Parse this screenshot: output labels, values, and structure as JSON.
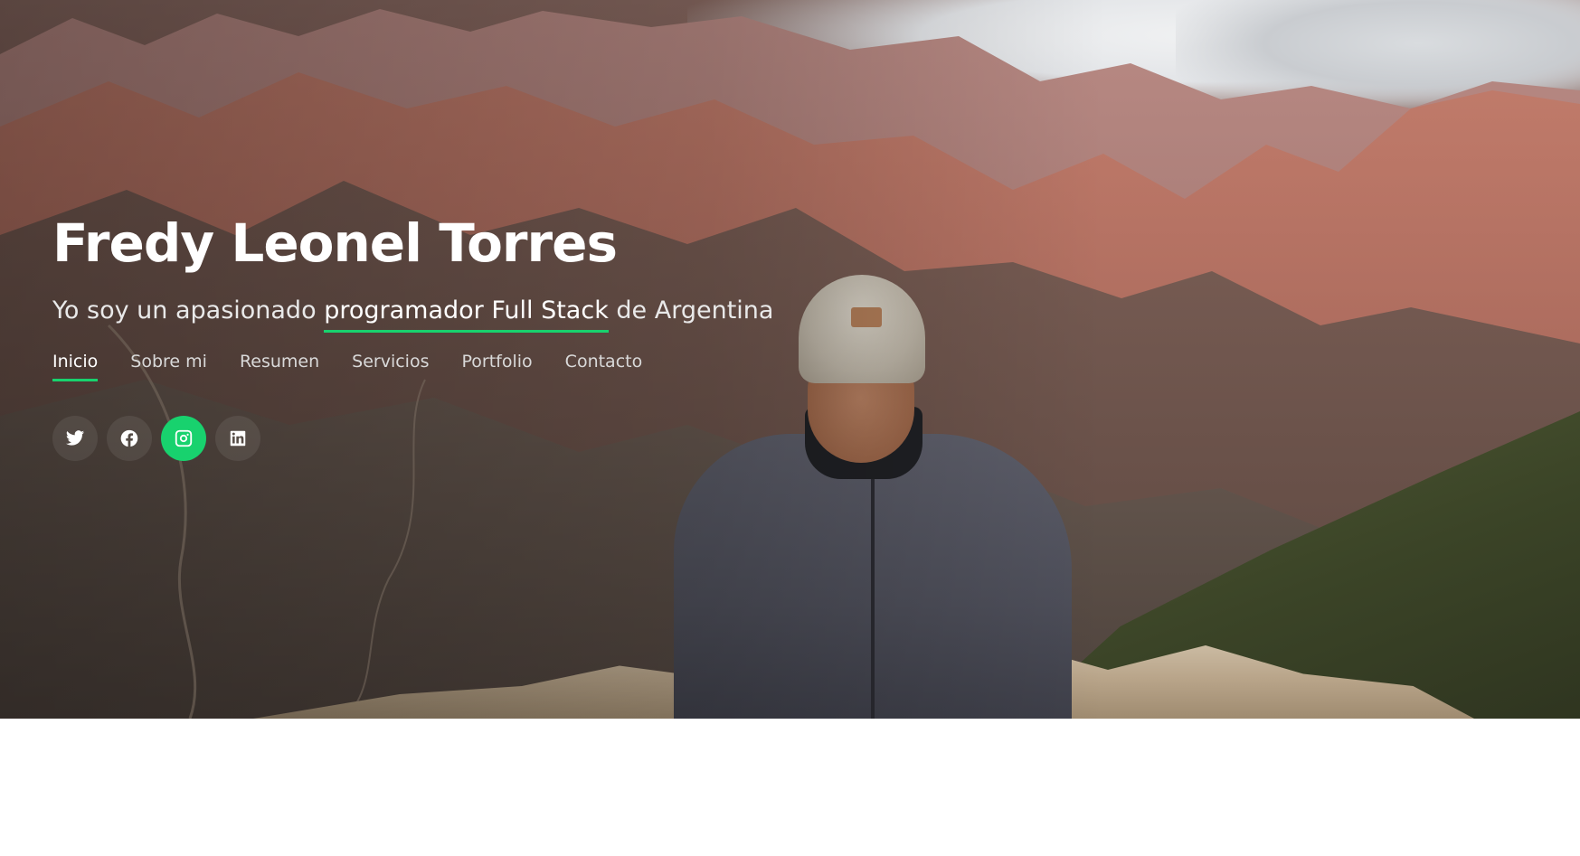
{
  "hero": {
    "name": "Fredy Leonel Torres",
    "tagline_prefix": "Yo soy un apasionado ",
    "tagline_highlight": "programador Full Stack",
    "tagline_suffix": " de Argentina"
  },
  "nav": {
    "items": [
      {
        "label": "Inicio",
        "active": true
      },
      {
        "label": "Sobre mi"
      },
      {
        "label": "Resumen"
      },
      {
        "label": "Servicios"
      },
      {
        "label": "Portfolio"
      },
      {
        "label": "Contacto"
      }
    ]
  },
  "social": {
    "items": [
      {
        "icon": "twitter-icon"
      },
      {
        "icon": "facebook-icon"
      },
      {
        "icon": "instagram-icon",
        "active": true
      },
      {
        "icon": "linkedin-icon"
      }
    ]
  },
  "colors": {
    "accent": "#18d26e",
    "text": "#ffffff"
  }
}
